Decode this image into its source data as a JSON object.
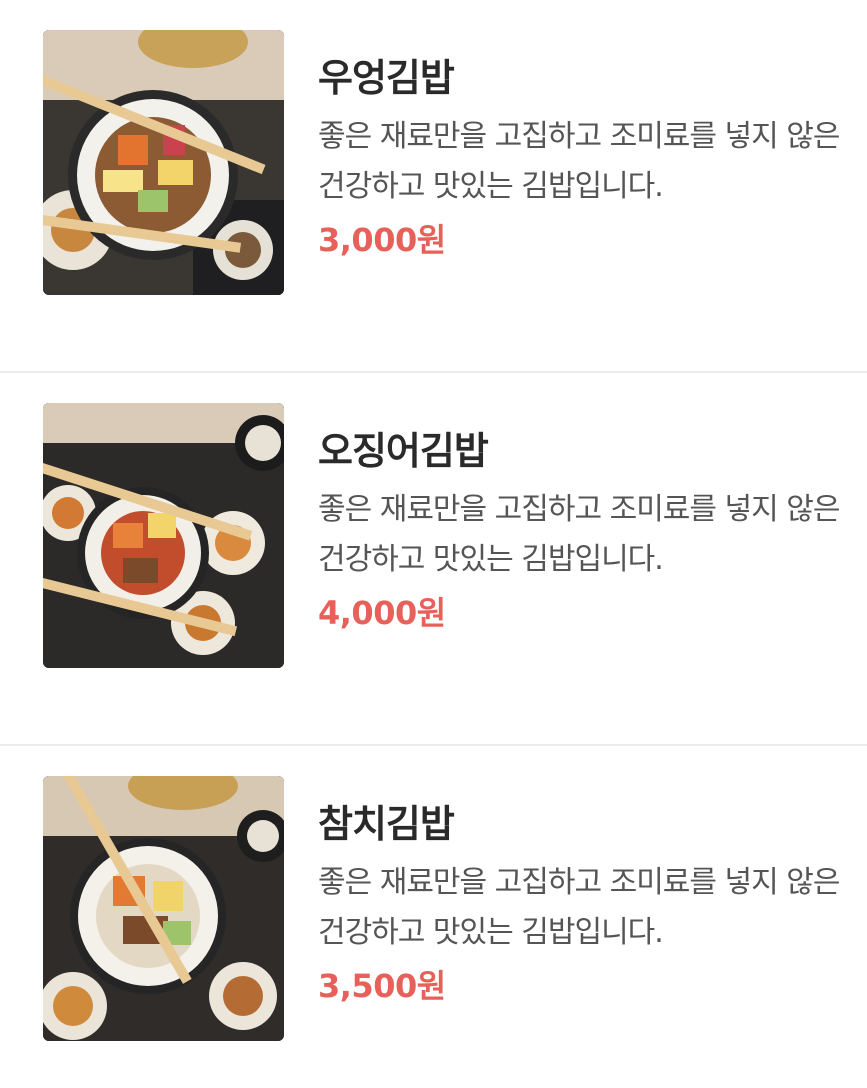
{
  "accent_color": "#e8605a",
  "menu_items": [
    {
      "name": "우엉김밥",
      "description": "좋은 재료만을 고집하고 조미료를 넣지 않은 건강하고 맛있는 김밥입니다.",
      "price": "3,000원",
      "image_icon": "kimbap-photo"
    },
    {
      "name": "오징어김밥",
      "description": "좋은 재료만을 고집하고 조미료를 넣지 않은 건강하고 맛있는 김밥입니다.",
      "price": "4,000원",
      "image_icon": "kimbap-photo"
    },
    {
      "name": "참치김밥",
      "description": "좋은 재료만을 고집하고 조미료를 넣지 않은 건강하고 맛있는 김밥입니다.",
      "price": "3,500원",
      "image_icon": "kimbap-photo"
    }
  ]
}
